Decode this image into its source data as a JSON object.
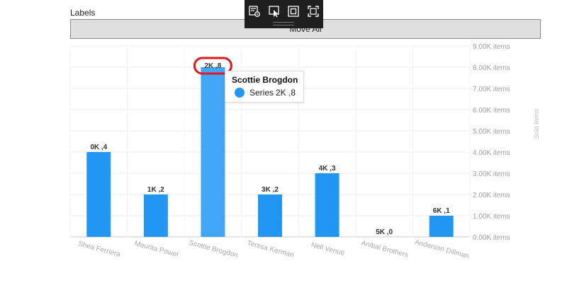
{
  "panel": {
    "title": "Labels",
    "move_all_label": "Move All"
  },
  "toolbar": {
    "icons": [
      "chart-settings-icon",
      "select-pointer-icon",
      "frame-icon",
      "fit-screen-icon"
    ]
  },
  "tooltip": {
    "title": "Scottie Brogdon",
    "series": "Series",
    "value": "2K ,8",
    "color": "#2196f3"
  },
  "chart_data": {
    "type": "bar",
    "categories": [
      "Shea Ferriera",
      "Maurita Powel",
      "Scottie Brogdon",
      "Teresa Kerman",
      "Nell Venuti",
      "Anibal Brothers",
      "Anderson Dillman"
    ],
    "series": [
      {
        "name": "Series",
        "values": [
          4000,
          2000,
          8000,
          2000,
          3000,
          0,
          1000
        ],
        "data_labels": [
          "0K ,4",
          "1K ,2",
          "2K ,8",
          "3K ,2",
          "4K ,3",
          "5K ,0",
          "6K ,1"
        ]
      }
    ],
    "y_ticks": [
      "0.00K items",
      "1.00K items",
      "2.00K items",
      "3.00K items",
      "4.00K items",
      "5.00K items",
      "6.00K items",
      "7.00K items",
      "8.00K items",
      "9.00K items"
    ],
    "ylabel": "Sold Items",
    "ylim": [
      0,
      9000
    ],
    "y_axis_position": "right",
    "grid": true,
    "highlighted_index": 2,
    "colors": {
      "bar": "#2196f3",
      "bar_hover": "#42a5f5",
      "highlight_ring": "#e3161c"
    }
  }
}
